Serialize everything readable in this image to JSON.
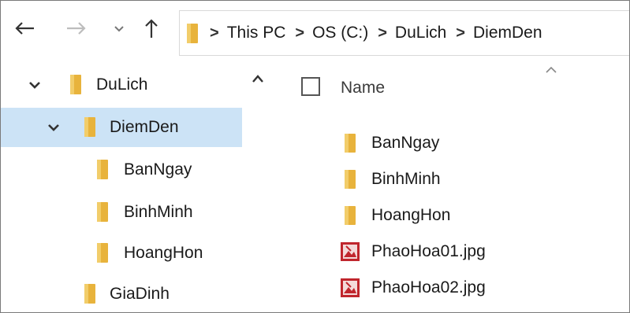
{
  "address_bar": {
    "breadcrumbs": [
      "This PC",
      "OS (C:)",
      "DuLich",
      "DiemDen"
    ],
    "separator": ">"
  },
  "nav_pane": {
    "items": [
      {
        "label": "DuLich",
        "expanded": true,
        "selected": false,
        "level": 0
      },
      {
        "label": "DiemDen",
        "expanded": true,
        "selected": true,
        "level": 1
      },
      {
        "label": "BanNgay",
        "level": 2
      },
      {
        "label": "BinhMinh",
        "level": 2
      },
      {
        "label": "HoangHon",
        "level": 2
      },
      {
        "label": "GiaDinh",
        "level": 1
      }
    ]
  },
  "file_list": {
    "column_header": "Name",
    "rows": [
      {
        "name": "BanNgay",
        "icon": "folder-icon"
      },
      {
        "name": "BinhMinh",
        "icon": "folder-icon"
      },
      {
        "name": "HoangHon",
        "icon": "folder-icon"
      },
      {
        "name": "PhaoHoa01.jpg",
        "icon": "image-file-icon"
      },
      {
        "name": "PhaoHoa02.jpg",
        "icon": "image-file-icon"
      }
    ]
  },
  "colors": {
    "folder": "#e8b33c",
    "selected_bg": "#cce3f6",
    "image_icon": "#c0262d"
  }
}
